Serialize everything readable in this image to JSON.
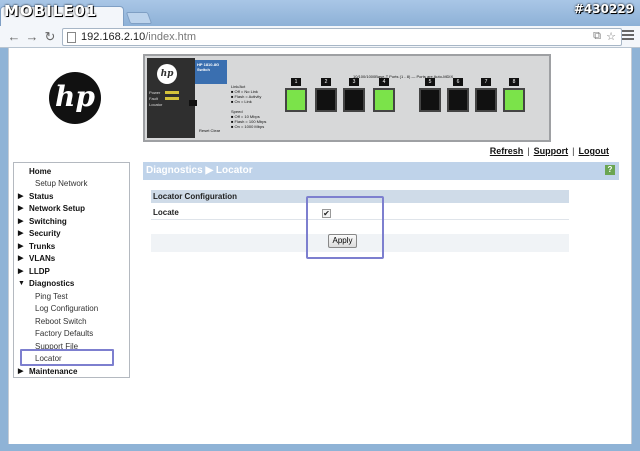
{
  "watermark": {
    "logo": "MOBILE01",
    "id": "#430229"
  },
  "browser": {
    "url_host": "192.168.2.10",
    "url_path": "/index.htm"
  },
  "switch_panel": {
    "model_label": "HP 1810-8G Switch",
    "led_labels": [
      "Power",
      "Fault",
      "Locator"
    ],
    "ports_title": "10/100/1000Base-T Ports (1 - 8) — Ports are Auto-MDIX",
    "port_numbers": [
      "1",
      "2",
      "3",
      "4",
      "5",
      "6",
      "7",
      "8"
    ],
    "reset_clear": "Reset   Clear"
  },
  "links": {
    "refresh": "Refresh",
    "support": "Support",
    "logout": "Logout"
  },
  "sidebar": {
    "items": [
      {
        "label": "Home",
        "type": "top"
      },
      {
        "label": "Setup Network",
        "type": "sub"
      },
      {
        "label": "Status",
        "type": "top",
        "arrow": "▶"
      },
      {
        "label": "Network Setup",
        "type": "top",
        "arrow": "▶"
      },
      {
        "label": "Switching",
        "type": "top",
        "arrow": "▶"
      },
      {
        "label": "Security",
        "type": "top",
        "arrow": "▶"
      },
      {
        "label": "Trunks",
        "type": "top",
        "arrow": "▶"
      },
      {
        "label": "VLANs",
        "type": "top",
        "arrow": "▶"
      },
      {
        "label": "LLDP",
        "type": "top",
        "arrow": "▶"
      },
      {
        "label": "Diagnostics",
        "type": "top",
        "arrow": "▼"
      },
      {
        "label": "Ping Test",
        "type": "sub"
      },
      {
        "label": "Log Configuration",
        "type": "sub"
      },
      {
        "label": "Reboot Switch",
        "type": "sub"
      },
      {
        "label": "Factory Defaults",
        "type": "sub"
      },
      {
        "label": "Support File",
        "type": "sub"
      },
      {
        "label": "Locator",
        "type": "sub"
      },
      {
        "label": "Maintenance",
        "type": "top",
        "arrow": "▶"
      }
    ]
  },
  "main": {
    "title": "Diagnostics ▶ Locator",
    "help": "?",
    "section_title": "Locator Configuration",
    "locate_label": "Locate",
    "locate_checked": "✔",
    "apply_label": "Apply"
  },
  "colors": {
    "header_bg": "#bfd3ea",
    "highlight": "#7d7fcf",
    "port_green": "#7be34a"
  }
}
